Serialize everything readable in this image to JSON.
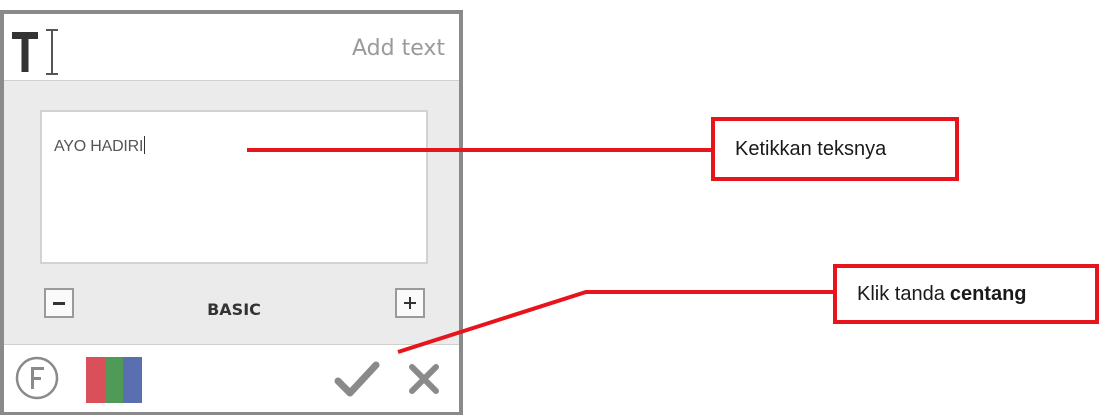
{
  "header": {
    "add_text_label": "Add text",
    "tool_icon": "text-cursor-icon"
  },
  "text_input": {
    "value": "AYO HADIRI"
  },
  "size_controls": {
    "minus_symbol": "−",
    "style_label": "BASIC",
    "plus_symbol": "+"
  },
  "footer": {
    "font_icon": "font-f-icon",
    "color_swatch": [
      "#d9505a",
      "#4f9a56",
      "#5a6fb0"
    ],
    "confirm_icon": "check-icon",
    "cancel_icon": "close-icon"
  },
  "annotations": {
    "type_text": "Ketikkan teksnya",
    "click_check_prefix": "Klik tanda",
    "click_check_bold": "centang"
  },
  "colors": {
    "accent_red": "#e8141b",
    "panel_border": "#8a8a8a",
    "icon_gray": "#8a8a8a"
  }
}
